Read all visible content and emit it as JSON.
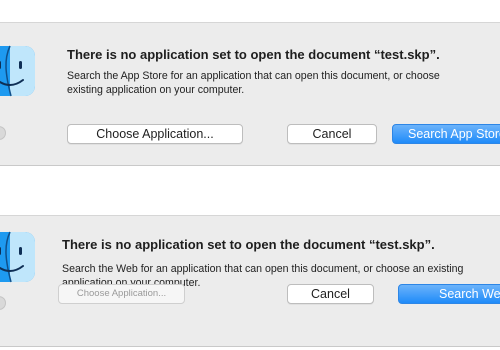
{
  "dialogs": [
    {
      "title": "There is no application set to open the document “test.skp”.",
      "message_line1": "Search the App Store for an application that can open this document, or choose",
      "message_line2": "existing application on your computer.",
      "choose_label": "Choose Application...",
      "cancel_label": "Cancel",
      "search_label": "Search App Store",
      "choose_disabled": false
    },
    {
      "title": "There is no application set to open the document “test.skp”.",
      "message_line1": "Search the Web for an application that can open this document, or choose an existing",
      "message_line2": "application on your computer.",
      "choose_label": "Choose Application...",
      "cancel_label": "Cancel",
      "search_label": "Search Web",
      "choose_disabled": true
    }
  ],
  "icon": "finder-icon",
  "colors": {
    "dialog_bg": "#ececec",
    "primary_button": "#1f8bf9",
    "finder_blue": "#1e9af0",
    "finder_light": "#bfe6fb"
  }
}
